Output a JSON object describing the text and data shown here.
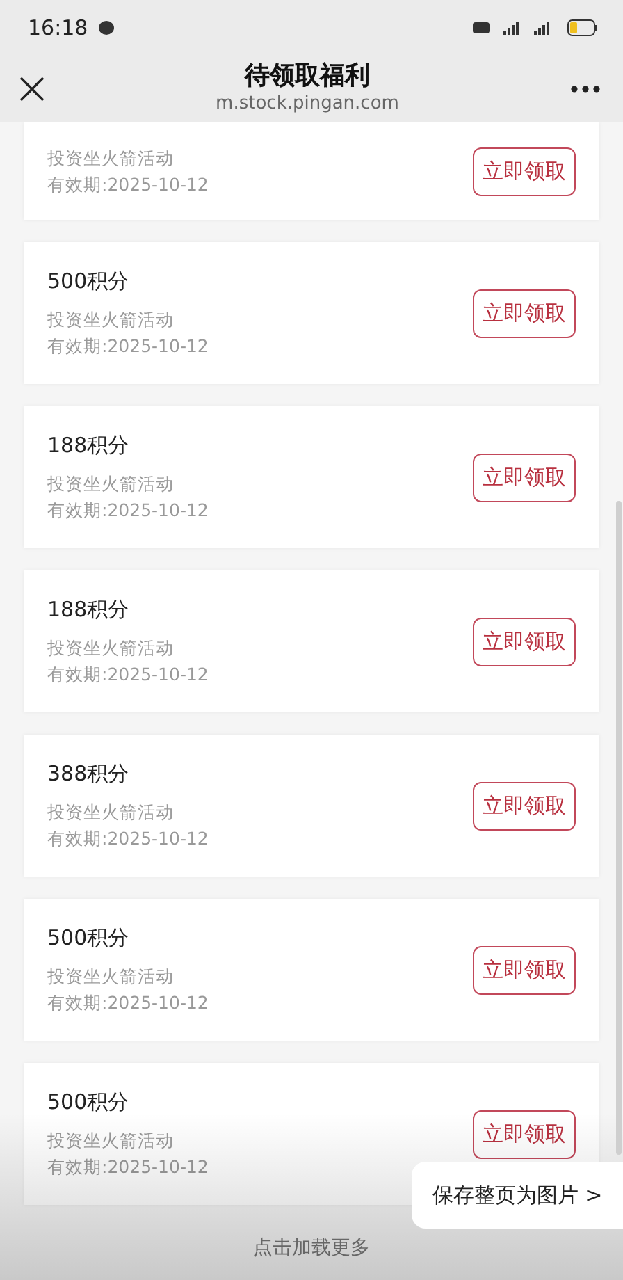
{
  "status_bar": {
    "time": "16:18"
  },
  "header": {
    "title": "待领取福利",
    "url": "m.stock.pingan.com"
  },
  "cards": [
    {
      "activity": "投资坐火箭活动",
      "expiry": "有效期:2025-10-12",
      "button": "立即领取"
    },
    {
      "title": "500积分",
      "activity": "投资坐火箭活动",
      "expiry": "有效期:2025-10-12",
      "button": "立即领取"
    },
    {
      "title": "188积分",
      "activity": "投资坐火箭活动",
      "expiry": "有效期:2025-10-12",
      "button": "立即领取"
    },
    {
      "title": "188积分",
      "activity": "投资坐火箭活动",
      "expiry": "有效期:2025-10-12",
      "button": "立即领取"
    },
    {
      "title": "388积分",
      "activity": "投资坐火箭活动",
      "expiry": "有效期:2025-10-12",
      "button": "立即领取"
    },
    {
      "title": "500积分",
      "activity": "投资坐火箭活动",
      "expiry": "有效期:2025-10-12",
      "button": "立即领取"
    },
    {
      "title": "500积分",
      "activity": "投资坐火箭活动",
      "expiry": "有效期:2025-10-12",
      "button": "立即领取"
    }
  ],
  "load_more": "点击加载更多",
  "save_button": "保存整页为图片 >"
}
